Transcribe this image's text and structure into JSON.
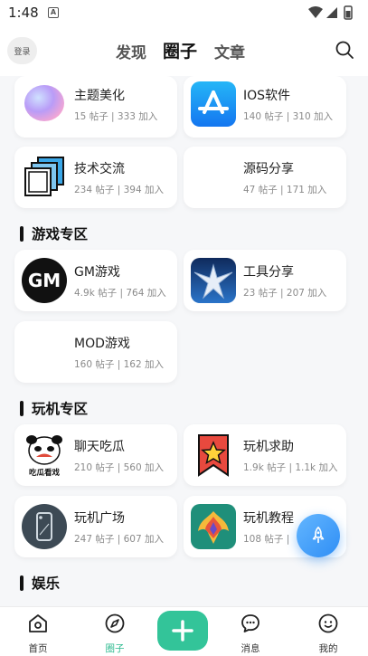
{
  "status": {
    "time": "1:48",
    "notif": "A"
  },
  "header": {
    "login_label": "登录",
    "tabs": [
      {
        "label": "发现"
      },
      {
        "label": "圈子"
      },
      {
        "label": "文章"
      }
    ],
    "active_tab": "圈子"
  },
  "sections": {
    "games": "游戏专区",
    "phone": "玩机专区",
    "fun": "娱乐"
  },
  "circles": [
    {
      "name": "主题美化",
      "posts": "15 帖子",
      "joins": "333 加入"
    },
    {
      "name": "IOS软件",
      "posts": "140 帖子",
      "joins": "310 加入"
    },
    {
      "name": "技术交流",
      "posts": "234 帖子",
      "joins": "394 加入"
    },
    {
      "name": "源码分享",
      "posts": "47 帖子",
      "joins": "171 加入"
    },
    {
      "name": "GM游戏",
      "posts": "4.9k 帖子",
      "joins": "764 加入"
    },
    {
      "name": "工具分享",
      "posts": "23 帖子",
      "joins": "207 加入"
    },
    {
      "name": "MOD游戏",
      "posts": "160 帖子",
      "joins": "162 加入"
    },
    {
      "name": "聊天吃瓜",
      "posts": "210 帖子",
      "joins": "560 加入"
    },
    {
      "name": "玩机求助",
      "posts": "1.9k 帖子",
      "joins": "1.1k 加入"
    },
    {
      "name": "玩机广场",
      "posts": "247 帖子",
      "joins": "607 加入"
    },
    {
      "name": "玩机教程",
      "posts": "108 帖子",
      "joins": ""
    }
  ],
  "thumb_text": {
    "gm": "GM",
    "melon": "吃瓜看戏"
  },
  "tabbar": [
    {
      "label": "首页"
    },
    {
      "label": "圈子"
    },
    {
      "label": ""
    },
    {
      "label": "消息"
    },
    {
      "label": "我的"
    }
  ],
  "colors": {
    "accent": "#2cba8f",
    "add_button": "#33c499",
    "fab": "#2f8ef5"
  }
}
